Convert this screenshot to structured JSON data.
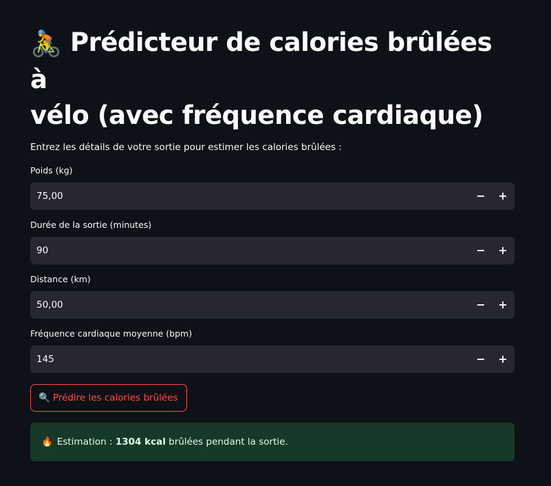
{
  "header": {
    "title_emoji": "🚴",
    "title_line1": "Prédicteur de calories brûlées à",
    "title_line2": "vélo (avec fréquence cardiaque)"
  },
  "intro": "Entrez les détails de votre sortie pour estimer les calories brûlées :",
  "fields": [
    {
      "label": "Poids (kg)",
      "value": "75,00",
      "minus": "−",
      "plus": "+"
    },
    {
      "label": "Durée de la sortie (minutes)",
      "value": "90",
      "minus": "−",
      "plus": "+"
    },
    {
      "label": "Distance (km)",
      "value": "50,00",
      "minus": "−",
      "plus": "+"
    },
    {
      "label": "Fréquence cardiaque moyenne (bpm)",
      "value": "145",
      "minus": "−",
      "plus": "+"
    }
  ],
  "predict_button": {
    "icon": "magnifier-icon",
    "icon_glyph": "🔍",
    "label": "Prédire les calories brûlées"
  },
  "result": {
    "icon": "fire-icon",
    "icon_glyph": "🔥",
    "prefix": "Estimation : ",
    "value": "1304 kcal",
    "suffix": " brûlées pendant la sortie."
  },
  "colors": {
    "background": "#0e1117",
    "input_background": "#262730",
    "accent": "#ff4b4b",
    "success_background": "#173928",
    "success_text": "#dffde9"
  }
}
